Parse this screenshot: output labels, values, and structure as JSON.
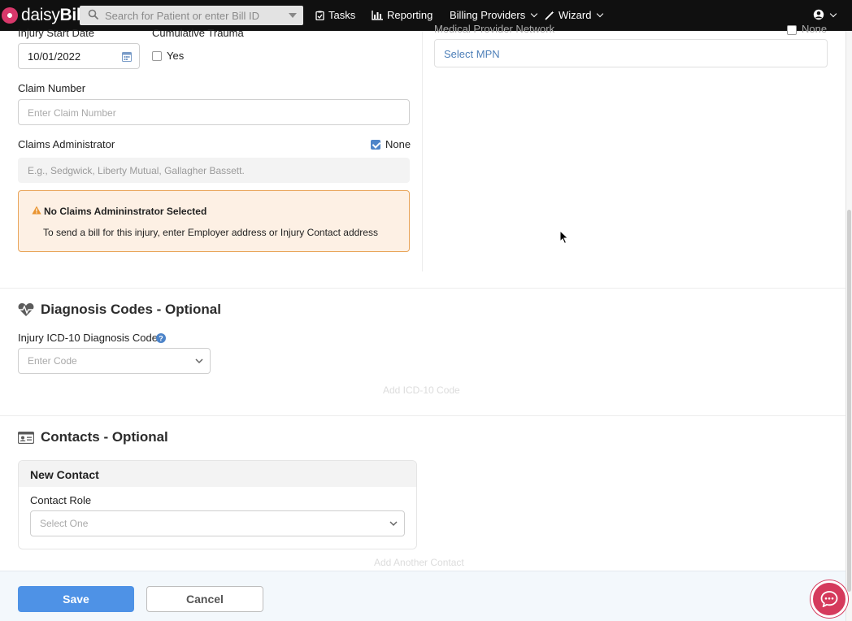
{
  "nav": {
    "logo": "daisyBill",
    "search_placeholder": "Search for Patient or enter Bill ID",
    "tasks": "Tasks",
    "reporting": "Reporting",
    "billing_providers": "Billing Providers",
    "wizard": "Wizard"
  },
  "injury": {
    "start_date_label": "Injury Start Date",
    "start_date_value": "10/01/2022",
    "cumulative_trauma_label": "Cumulative Trauma",
    "cumulative_trauma_option": "Yes",
    "cumulative_trauma_checked": false,
    "claim_number_label": "Claim Number",
    "claim_number_placeholder": "Enter Claim Number",
    "claims_admin_label": "Claims Administrator",
    "claims_admin_none_label": "None",
    "claims_admin_none_checked": true,
    "claims_admin_placeholder": "E.g., Sedgwick, Liberty Mutual, Gallagher Bassett.",
    "alert_title": "No Claims Admininstrator Selected",
    "alert_body": "To send a bill for this injury, enter Employer address or Injury Contact address"
  },
  "mpn": {
    "label": "Medical Provider Network",
    "none_label": "None",
    "select_placeholder": "Select MPN"
  },
  "diagnosis": {
    "section_title": "Diagnosis Codes - Optional",
    "field_label": "Injury ICD-10 Diagnosis Code",
    "placeholder": "Enter Code",
    "add_button": "Add ICD-10 Code"
  },
  "contacts": {
    "section_title": "Contacts - Optional",
    "card_title": "New Contact",
    "role_label": "Contact Role",
    "role_placeholder": "Select One",
    "add_button": "Add Another Contact"
  },
  "footer": {
    "save": "Save",
    "cancel": "Cancel"
  },
  "colors": {
    "nav_bg": "#101010",
    "primary": "#4e92e6",
    "alert_bg": "#fdf0e4",
    "alert_border": "#e9a55a",
    "chat": "#d53a5c"
  }
}
